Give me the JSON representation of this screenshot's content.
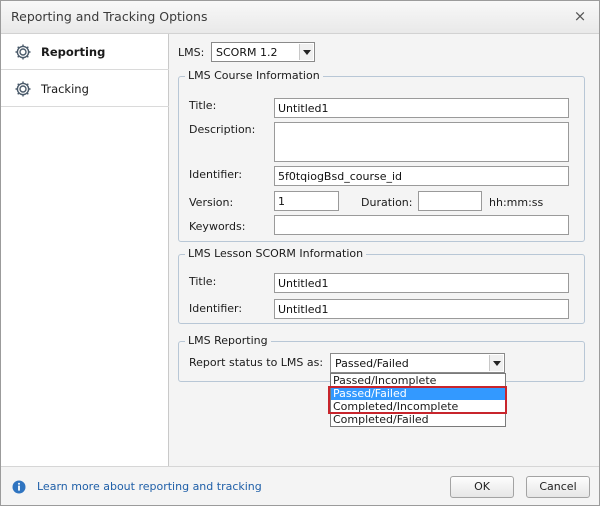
{
  "window": {
    "title": "Reporting and Tracking Options",
    "close_glyph": "×"
  },
  "sidebar": {
    "items": [
      {
        "label": "Reporting",
        "icon": "gear-icon",
        "active": true
      },
      {
        "label": "Tracking",
        "icon": "gear-icon",
        "active": false
      }
    ]
  },
  "lms": {
    "label": "LMS:",
    "selected": "SCORM 1.2"
  },
  "course_info": {
    "group_title": "LMS Course Information",
    "title_label": "Title:",
    "title_value": "Untitled1",
    "description_label": "Description:",
    "description_value": "",
    "identifier_label": "Identifier:",
    "identifier_value": "5f0tqiogBsd_course_id",
    "version_label": "Version:",
    "version_value": "1",
    "duration_label": "Duration:",
    "duration_value": "",
    "duration_unit": "hh:mm:ss",
    "keywords_label": "Keywords:",
    "keywords_value": ""
  },
  "lesson_info": {
    "group_title": "LMS Lesson SCORM Information",
    "title_label": "Title:",
    "title_value": "Untitled1",
    "identifier_label": "Identifier:",
    "identifier_value": "Untitled1"
  },
  "reporting": {
    "group_title": "LMS Reporting",
    "status_label": "Report status to LMS as:",
    "status_selected": "Passed/Failed",
    "options": [
      "Passed/Incomplete",
      "Passed/Failed",
      "Completed/Incomplete",
      "Completed/Failed"
    ],
    "highlighted_index": 1
  },
  "footer": {
    "help_link": "Learn more about reporting and tracking",
    "ok_label": "OK",
    "cancel_label": "Cancel"
  },
  "colors": {
    "selection": "#3399ff",
    "highlight_border": "#c8252c",
    "link": "#1f5fa8"
  }
}
